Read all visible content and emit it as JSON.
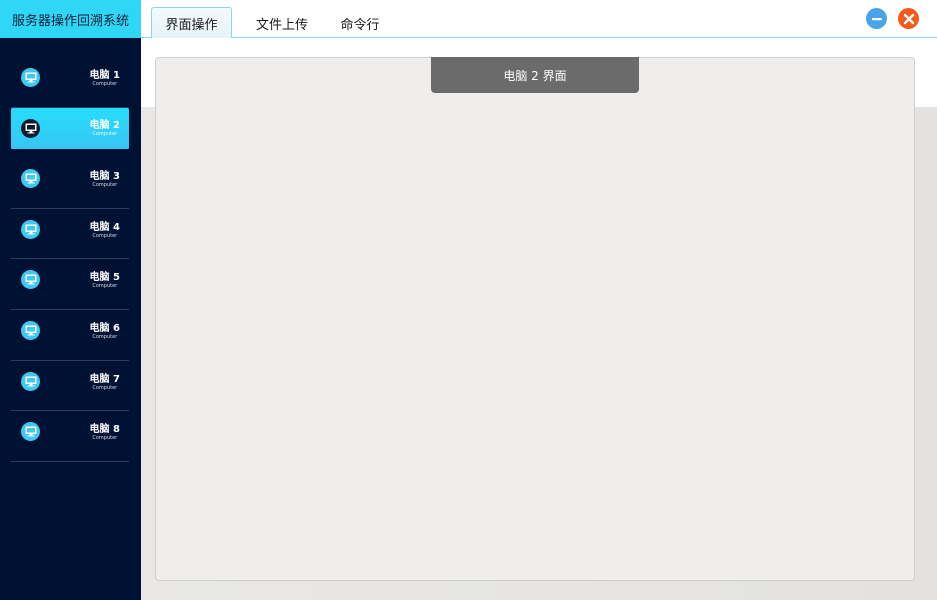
{
  "app": {
    "title": "服务器操作回溯系统"
  },
  "tabs": [
    {
      "label": "界面操作",
      "active": true
    },
    {
      "label": "文件上传",
      "active": false
    },
    {
      "label": "命令行",
      "active": false
    }
  ],
  "computers": [
    {
      "name": "电脑 1",
      "sub": "Computer",
      "active": false
    },
    {
      "name": "电脑 2",
      "sub": "Computer",
      "active": true
    },
    {
      "name": "电脑 3",
      "sub": "Computer",
      "active": false
    },
    {
      "name": "电脑 4",
      "sub": "Computer",
      "active": false
    },
    {
      "name": "电脑 5",
      "sub": "Computer",
      "active": false
    },
    {
      "name": "电脑 6",
      "sub": "Computer",
      "active": false
    },
    {
      "name": "电脑 7",
      "sub": "Computer",
      "active": false
    },
    {
      "name": "电脑 8",
      "sub": "Computer",
      "active": false
    }
  ],
  "main": {
    "screen_title": "电脑 2 界面"
  },
  "window_controls": {
    "minimize_icon": "minus-icon",
    "close_icon": "close-icon"
  },
  "colors": {
    "sidebar_bg": "#001233",
    "accent_cyan": "#2fd6f6",
    "minimize": "#4aa5e8",
    "close": "#f35a1b",
    "screen_tab": "#6b6b6b"
  }
}
